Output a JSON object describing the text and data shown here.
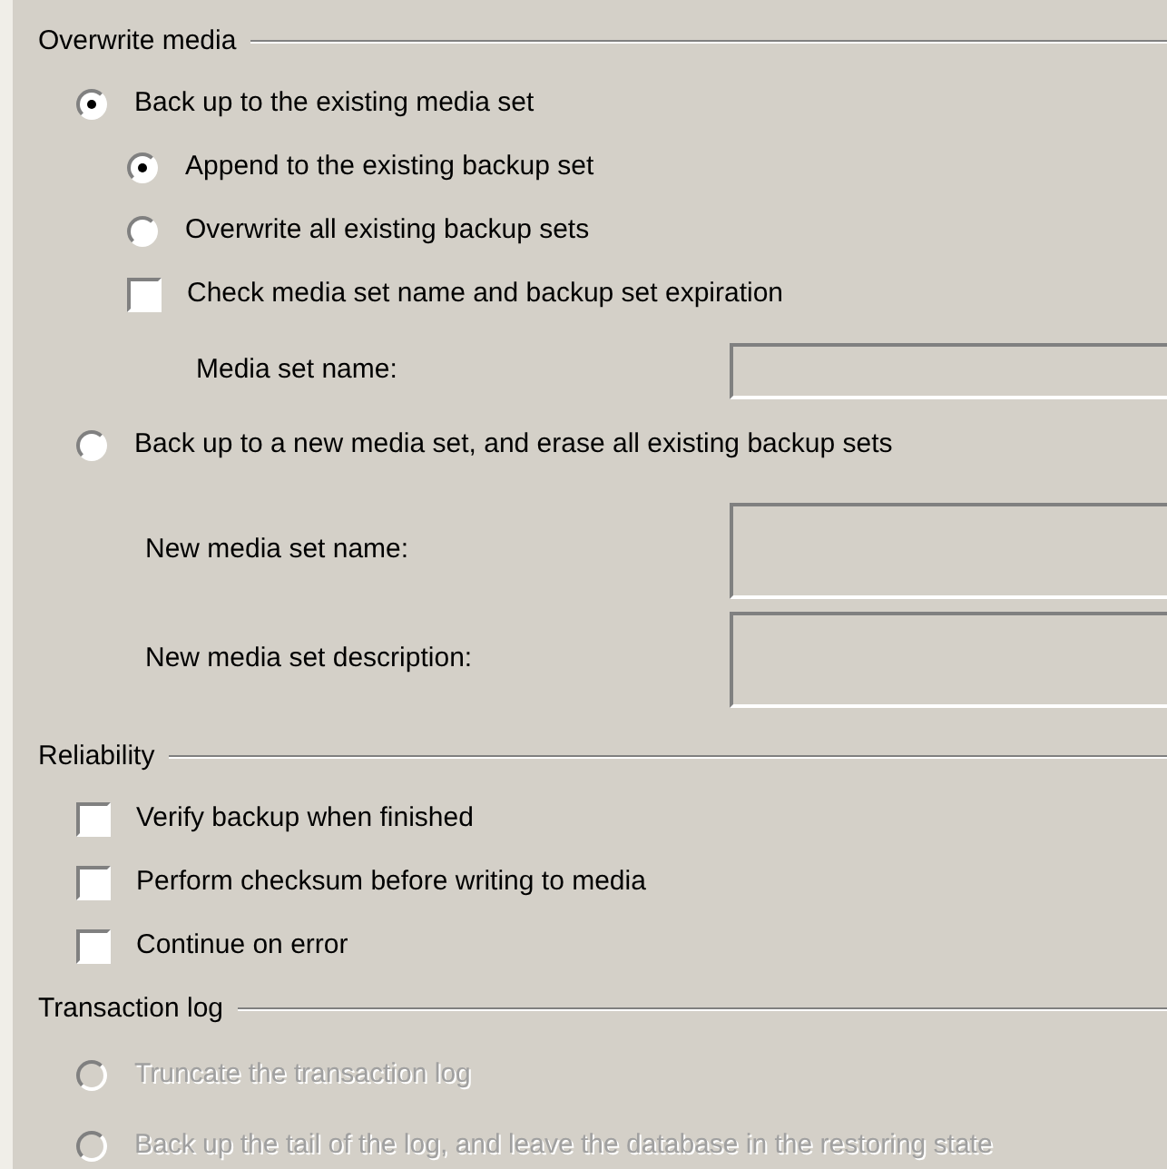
{
  "sections": [
    {
      "title": "Overwrite media",
      "items": [
        {
          "kind": "radio",
          "label": "Back up to the existing media set",
          "selected": true,
          "disabled": false,
          "children": [
            {
              "kind": "radio",
              "label": "Append to the existing backup set",
              "selected": true,
              "disabled": false
            },
            {
              "kind": "radio",
              "label": "Overwrite all existing backup sets",
              "selected": false,
              "disabled": false
            },
            {
              "kind": "checkbox",
              "label": "Check media set name and backup set expiration",
              "checked": false
            },
            {
              "kind": "field",
              "label": "Media set name:"
            }
          ]
        },
        {
          "kind": "radio",
          "label": "Back up to a new media set, and erase all existing backup sets",
          "selected": false,
          "disabled": false,
          "children": [
            {
              "kind": "textarea",
              "label": "New media set name:"
            },
            {
              "kind": "textarea",
              "label": "New media set description:"
            }
          ]
        }
      ]
    },
    {
      "title": "Reliability",
      "items": [
        {
          "kind": "checkbox",
          "label": "Verify backup when finished",
          "checked": false
        },
        {
          "kind": "checkbox",
          "label": "Perform checksum before writing to media",
          "checked": false
        },
        {
          "kind": "checkbox",
          "label": "Continue on error",
          "checked": false
        }
      ]
    },
    {
      "title": "Transaction log",
      "items": [
        {
          "kind": "radio",
          "label": "Truncate the transaction log",
          "selected": false,
          "disabled": true
        },
        {
          "kind": "radio",
          "label": "Back up the tail of the log, and leave the database in the restoring state",
          "selected": false,
          "disabled": true
        }
      ]
    }
  ]
}
